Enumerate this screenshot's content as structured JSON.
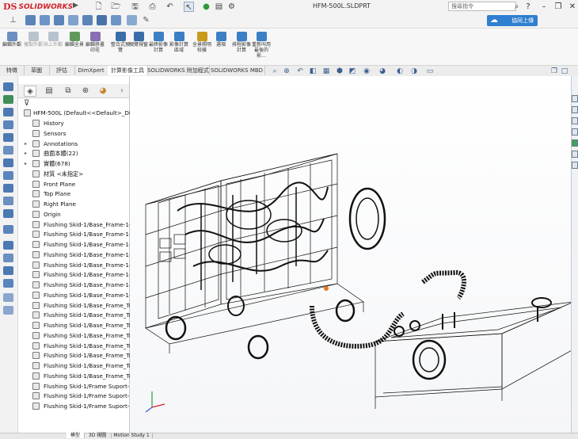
{
  "title_bar": {
    "brand": "SOLIDWORKS",
    "brand_mark": "DS",
    "document_title": "HFM-500L.SLDPRT",
    "search_placeholder": "搜尋指令",
    "quick_icons": [
      "new-icon",
      "open-icon",
      "save-icon",
      "print-icon",
      "undo-icon",
      "select-icon",
      "rebuild-icon",
      "file-properties-icon",
      "options-icon"
    ],
    "window_controls": [
      "help-icon",
      "minimize-icon",
      "restore-icon",
      "close-icon"
    ]
  },
  "toolbar2": {
    "upload_label": "協同上傳"
  },
  "command_manager": [
    {
      "label": "編輯外觀",
      "enabled": true,
      "color": "#6b8fc2"
    },
    {
      "label": "複製外觀",
      "enabled": false,
      "color": "#b9c3cf"
    },
    {
      "label": "貼上外觀",
      "enabled": false,
      "color": "#b9c3cf"
    },
    {
      "label": "編輯全景",
      "enabled": true,
      "color": "#5f9a5a"
    },
    {
      "label": "編輯移畫印花",
      "enabled": true,
      "color": "#8a6db3"
    },
    {
      "label": "整合式預覽",
      "enabled": true,
      "color": "#3a6ea8"
    },
    {
      "label": "預覽視窗",
      "enabled": true,
      "color": "#3a6ea8"
    },
    {
      "label": "最終影像計算",
      "enabled": true,
      "color": "#3b7fc4"
    },
    {
      "label": "影像計算區域",
      "enabled": true,
      "color": "#3b7fc4"
    },
    {
      "label": "全景照明校樣",
      "enabled": true,
      "color": "#c99a1e"
    },
    {
      "label": "選項",
      "enabled": true,
      "color": "#3b7fc4"
    },
    {
      "label": "排程影像計算",
      "enabled": true,
      "color": "#3b7fc4"
    },
    {
      "label": "重新叫用最後的影...",
      "enabled": true,
      "color": "#3b7fc4"
    }
  ],
  "tabs": [
    {
      "label": "特徵",
      "active": false
    },
    {
      "label": "草圖",
      "active": false
    },
    {
      "label": "評估",
      "active": false
    },
    {
      "label": "DimXpert",
      "active": false
    },
    {
      "label": "計算影像工具",
      "active": true
    },
    {
      "label": "SOLIDWORKS 附加程式",
      "active": false
    },
    {
      "label": "SOLIDWORKS MBD",
      "active": false
    }
  ],
  "feature_manager": {
    "root": "HFM-500L  (Default<<Default>_Di",
    "items": [
      {
        "label": "History",
        "expand": false,
        "icon": "history-icon"
      },
      {
        "label": "Sensors",
        "expand": false,
        "icon": "sensors-icon"
      },
      {
        "label": "Annotations",
        "expand": true,
        "icon": "annotations-icon"
      },
      {
        "label": "曲面本體(22)",
        "expand": true,
        "icon": "surface-bodies-icon"
      },
      {
        "label": "實體(678)",
        "expand": true,
        "icon": "solid-bodies-icon"
      },
      {
        "label": "材質 <未指定>",
        "expand": false,
        "icon": "material-icon"
      },
      {
        "label": "Front Plane",
        "expand": false,
        "icon": "plane-icon"
      },
      {
        "label": "Top Plane",
        "expand": false,
        "icon": "plane-icon"
      },
      {
        "label": "Right Plane",
        "expand": false,
        "icon": "plane-icon"
      },
      {
        "label": "Origin",
        "expand": false,
        "icon": "origin-icon"
      },
      {
        "label": "Flushing Skid-1/Base_Frame-1-",
        "expand": false,
        "icon": "imported-feature-icon"
      },
      {
        "label": "Flushing Skid-1/Base_Frame-1-",
        "expand": false,
        "icon": "imported-feature-icon"
      },
      {
        "label": "Flushing Skid-1/Base_Frame-1-",
        "expand": false,
        "icon": "imported-feature-icon"
      },
      {
        "label": "Flushing Skid-1/Base_Frame-1-",
        "expand": false,
        "icon": "imported-feature-icon"
      },
      {
        "label": "Flushing Skid-1/Base_Frame-1-",
        "expand": false,
        "icon": "imported-feature-icon"
      },
      {
        "label": "Flushing Skid-1/Base_Frame-1-",
        "expand": false,
        "icon": "imported-feature-icon"
      },
      {
        "label": "Flushing Skid-1/Base_Frame-1-",
        "expand": false,
        "icon": "imported-feature-icon"
      },
      {
        "label": "Flushing Skid-1/Base_Frame-1-",
        "expand": false,
        "icon": "imported-feature-icon"
      },
      {
        "label": "Flushing Skid-1/Base_Frame_Tc",
        "expand": false,
        "icon": "imported-feature-icon"
      },
      {
        "label": "Flushing Skid-1/Base_Frame_Tc",
        "expand": false,
        "icon": "imported-feature-icon"
      },
      {
        "label": "Flushing Skid-1/Base_Frame_Tc",
        "expand": false,
        "icon": "imported-feature-icon"
      },
      {
        "label": "Flushing Skid-1/Base_Frame_Tc",
        "expand": false,
        "icon": "imported-feature-icon"
      },
      {
        "label": "Flushing Skid-1/Base_Frame_Tc",
        "expand": false,
        "icon": "imported-feature-icon"
      },
      {
        "label": "Flushing Skid-1/Base_Frame_Tc",
        "expand": false,
        "icon": "imported-feature-icon"
      },
      {
        "label": "Flushing Skid-1/Base_Frame_Tc",
        "expand": false,
        "icon": "imported-feature-icon"
      },
      {
        "label": "Flushing Skid-1/Base_Frame_Tc",
        "expand": false,
        "icon": "imported-feature-icon"
      },
      {
        "label": "Flushing Skid-1/Frame Suport-",
        "expand": false,
        "icon": "imported-feature-icon"
      },
      {
        "label": "Flushing Skid-1/Frame Suport-",
        "expand": false,
        "icon": "imported-feature-icon"
      },
      {
        "label": "Flushing Skid-1/Frame Suport-",
        "expand": false,
        "icon": "imported-feature-icon"
      }
    ]
  },
  "bottom_tabs": [
    "模型",
    "3D 視圖",
    "Motion Study 1"
  ],
  "colors": {
    "brand_red": "#d2232a",
    "accent_blue": "#2f7fd0",
    "wire": "#111111"
  }
}
